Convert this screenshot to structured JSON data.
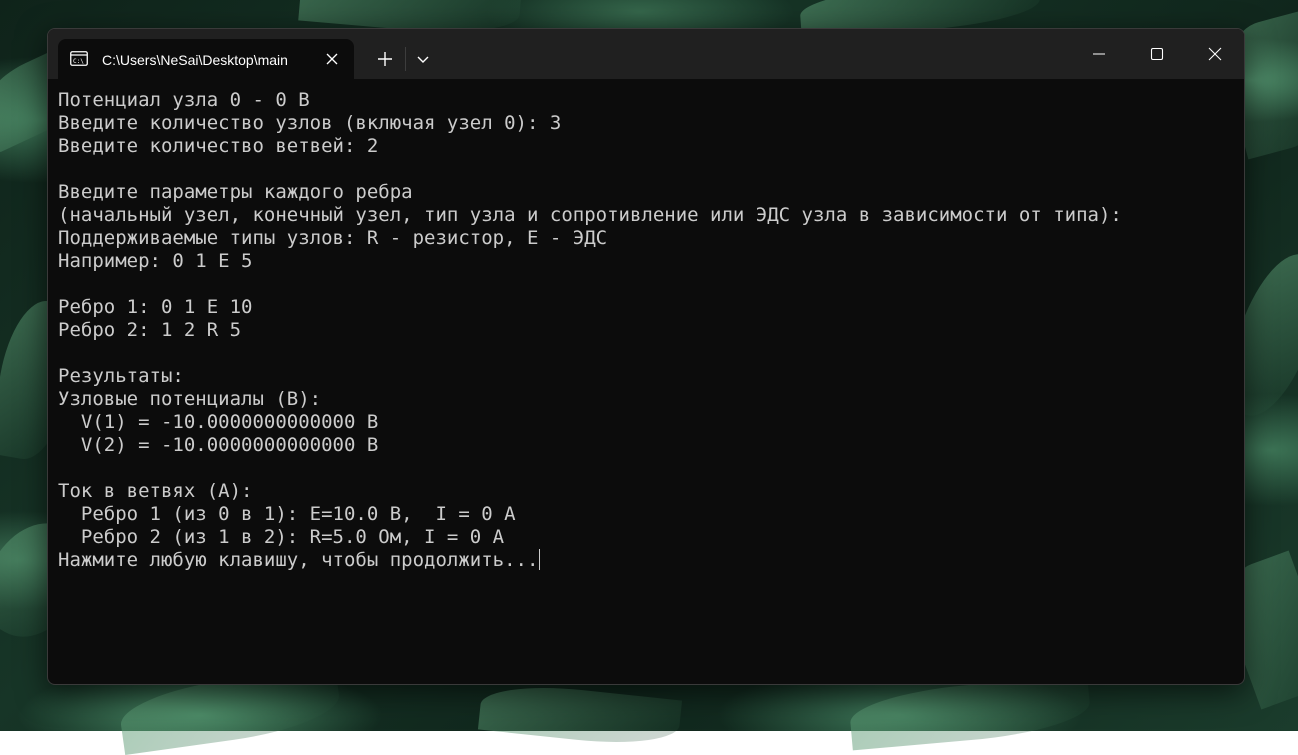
{
  "window": {
    "tab_title": "C:\\Users\\NeSai\\Desktop\\main"
  },
  "icons": {
    "tab": "terminal-icon",
    "tab_close": "close-icon",
    "new_tab": "plus-icon",
    "dropdown": "chevron-down-icon",
    "minimize": "minimize-icon",
    "maximize": "maximize-icon",
    "close": "close-icon"
  },
  "colors": {
    "terminal_bg": "#0c0c0c",
    "terminal_text": "#cccccc",
    "titlebar_bg": "#202020"
  },
  "terminal": {
    "lines": [
      "Потенциал узла 0 - 0 В",
      "Введите количество узлов (включая узел 0): 3",
      "Введите количество ветвей: 2",
      "",
      "Введите параметры каждого ребра",
      "(начальный узел, конечный узел, тип узла и сопротивление или ЭДС узла в зависимости от типа):",
      "Поддерживаемые типы узлов: R - резистор, E - ЭДС",
      "Например: 0 1 E 5",
      "",
      "Ребро 1: 0 1 E 10",
      "Ребро 2: 1 2 R 5",
      "",
      "Результаты:",
      "Узловые потенциалы (В):",
      "  V(1) = -10.0000000000000 В",
      "  V(2) = -10.0000000000000 В",
      "",
      "Ток в ветвях (А):",
      "  Ребро 1 (из 0 в 1): E=10.0 В,  I = 0 А",
      "  Ребро 2 (из 1 в 2): R=5.0 Ом, I = 0 А",
      "Нажмите любую клавишу, чтобы продолжить..."
    ]
  }
}
